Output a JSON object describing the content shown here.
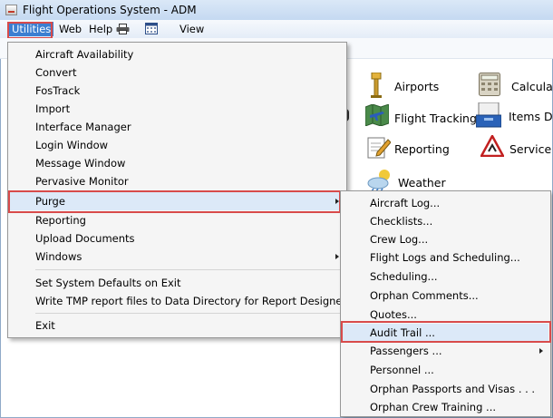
{
  "window": {
    "title": "Flight Operations System - ADM"
  },
  "menubar": {
    "utilities": "Utilities",
    "web": "Web",
    "help": "Help",
    "view": "View"
  },
  "utilities_menu": {
    "items": [
      "Aircraft Availability",
      "Convert",
      "FosTrack",
      "Import",
      "Interface Manager",
      "Login Window",
      "Message Window",
      "Pervasive Monitor",
      "Purge",
      "Reporting",
      "Upload Documents",
      "Windows",
      "Set System Defaults on Exit",
      "Write TMP report files to Data Directory for Report Designer",
      "Exit"
    ]
  },
  "purge_menu": {
    "items": [
      "Aircraft Log...",
      "Checklists...",
      "Crew Log...",
      "Flight Logs and Scheduling...",
      "Scheduling...",
      "Orphan Comments...",
      "Quotes...",
      "Audit Trail ...",
      "Passengers ...",
      "Personnel ...",
      "Orphan Passports and Visas . . .",
      "Orphan Crew Training ..."
    ]
  },
  "main_icons": {
    "airports": "Airports",
    "calculator": "Calculato",
    "flight_tracking": "Flight Tracking",
    "items_due": "Items Du",
    "reporting": "Reporting",
    "service": "Service &",
    "weather": "Weather"
  }
}
